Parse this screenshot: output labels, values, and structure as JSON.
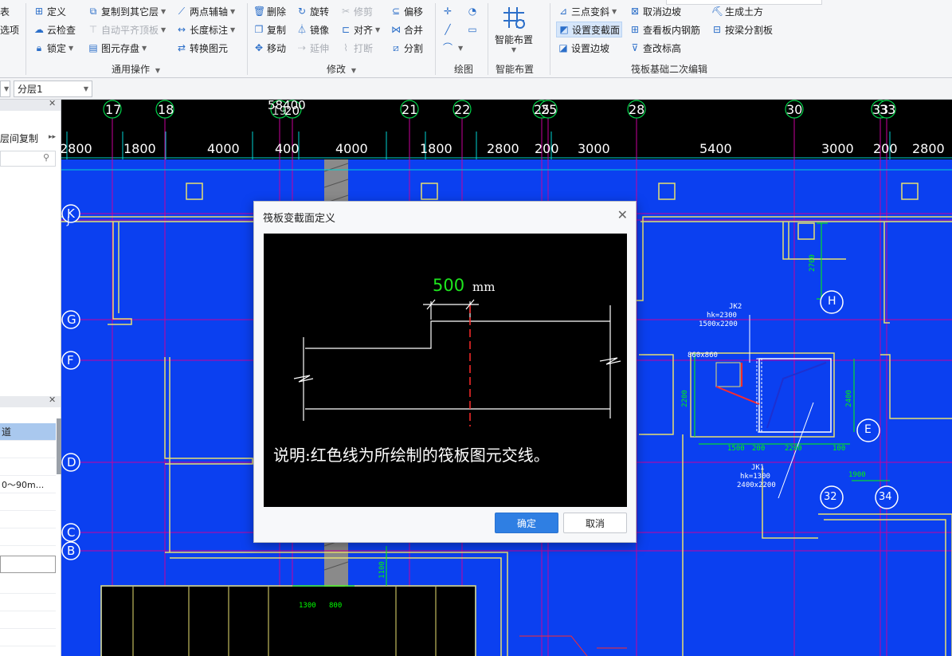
{
  "ribbon": {
    "col1": [
      "表",
      "选项"
    ],
    "general": {
      "define": "定义",
      "cloud_check": "云检查",
      "lock": "锁定",
      "copy_to_layer": "复制到其它层",
      "auto_align_top": "自动平齐顶板",
      "element_save": "图元存盘",
      "two_point_aux": "两点辅轴",
      "length_dim": "长度标注",
      "convert_element": "转换图元",
      "group_label": "通用操作"
    },
    "modify": {
      "delete": "删除",
      "copy": "复制",
      "move": "移动",
      "rotate": "旋转",
      "mirror": "镜像",
      "extend": "延伸",
      "trim": "修剪",
      "align": "对齐",
      "break": "打断",
      "offset": "偏移",
      "merge": "合并",
      "split": "分割",
      "group_label": "修改"
    },
    "draw": {
      "group_label": "绘图"
    },
    "smart": {
      "button": "智能布置",
      "group_label": "智能布置"
    },
    "raft": {
      "three_point_slope": "三点变斜",
      "set_section": "设置变截面",
      "set_edge_slope": "设置边坡",
      "cancel_edge_slope": "取消边坡",
      "view_rebar": "查看板内钢筋",
      "modify_elevation": "查改标高",
      "gen_earthwork": "生成土方",
      "split_by_beam": "按梁分割板",
      "group_label": "筏板基础二次编辑"
    }
  },
  "toolbar2": {
    "layer": "分层1"
  },
  "left_panel": {
    "copy_between_floors": "层间复制",
    "prop_header": "道",
    "prop_value": "0～90m..."
  },
  "canvas": {
    "top_axes": [
      "17",
      "18",
      "58400",
      "19",
      "20",
      "21",
      "22",
      "25",
      "25",
      "28",
      "30",
      "33",
      "33"
    ],
    "dims": [
      "2800",
      "1800",
      "4000",
      "400",
      "4000",
      "1800",
      "2800",
      "200",
      "3000",
      "5400",
      "3000",
      "200",
      "2800"
    ],
    "row_axes": [
      "K",
      "J",
      "G",
      "F",
      "D",
      "C",
      "B"
    ],
    "circle_labels": [
      "H",
      "E",
      "32",
      "34"
    ],
    "annotations": {
      "jk2": "JK2",
      "jk2_hk": "hk=2300",
      "jk2_size": "1500x2200",
      "jk1": "JK1",
      "jk1_hk": "hk=1300",
      "jk1_size": "2400x2200",
      "size_860": "860x860",
      "d2700": "2700",
      "d2200": "2200",
      "d2400": "2400",
      "d1500": "1500",
      "d200": "200",
      "d2200b": "2200",
      "d100": "100",
      "d1900": "1900",
      "d1100": "1100",
      "d1300": "1300",
      "d800": "800"
    }
  },
  "dialog": {
    "title": "筏板变截面定义",
    "dim_value": "500",
    "dim_unit": "mm",
    "note": "说明:红色线为所绘制的筏板图元交线。",
    "ok": "确定",
    "cancel": "取消"
  },
  "colors": {
    "canvas_blue": "#0b40f0",
    "axis_magenta": "#c8009b",
    "grid_cyan": "#00d2d2",
    "wall_yellow": "#e8e070",
    "accent": "#2f7fe3"
  }
}
